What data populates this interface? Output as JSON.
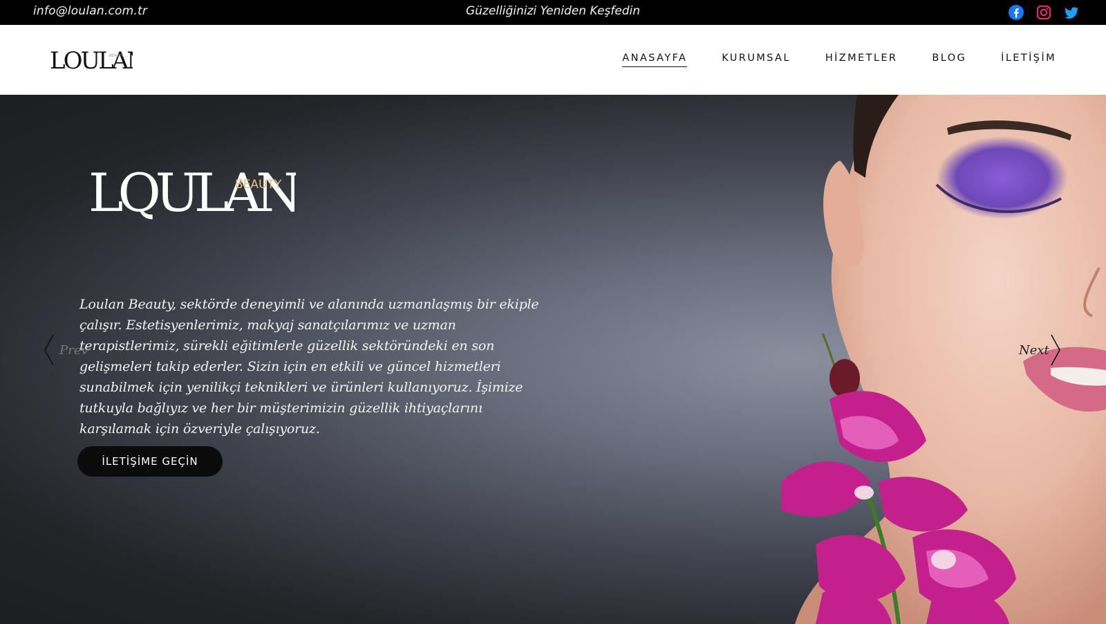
{
  "topbar": {
    "email": "info@loulan.com.tr",
    "tagline": "Güzelliğinizi Yeniden Keşfedin",
    "social": [
      {
        "icon": "facebook-icon",
        "color": "#1877F2"
      },
      {
        "icon": "instagram-icon",
        "color": "#E1306C"
      },
      {
        "icon": "twitter-icon",
        "color": "#1DA1F2"
      }
    ]
  },
  "header": {
    "logo_text": "LOULAN",
    "logo_sub": "BEAUTY",
    "nav": [
      {
        "label": "ANASAYFA",
        "active": true
      },
      {
        "label": "KURUMSAL"
      },
      {
        "label": "HİZMETLER"
      },
      {
        "label": "BLOG"
      },
      {
        "label": "İLETİŞİM"
      }
    ]
  },
  "hero": {
    "logo_text": "LQULAN",
    "logo_sub": "BEAUTY",
    "description": "Loulan Beauty, sektörde deneyimli ve alanında uzmanlaşmış bir ekiple çalışır. Estetisyenlerimiz, makyaj sanatçılarımız ve uzman terapistlerimiz, sürekli eğitimlerle güzellik sektöründeki en son gelişmeleri takip ederler. Sizin için en etkili ve güncel hizmetleri sunabilmek için yenilikçi teknikleri ve ürünleri kullanıyoruz. İşimize tutkuyla bağlıyız ve her bir müşterimizin güzellik ihtiyaçlarını karşılamak için özveriyle çalışıyoruz.",
    "cta_label": "İLETİŞİME GEÇİN",
    "prev_label": "Prev",
    "next_label": "Next",
    "accent_color": "#E8C48A"
  }
}
